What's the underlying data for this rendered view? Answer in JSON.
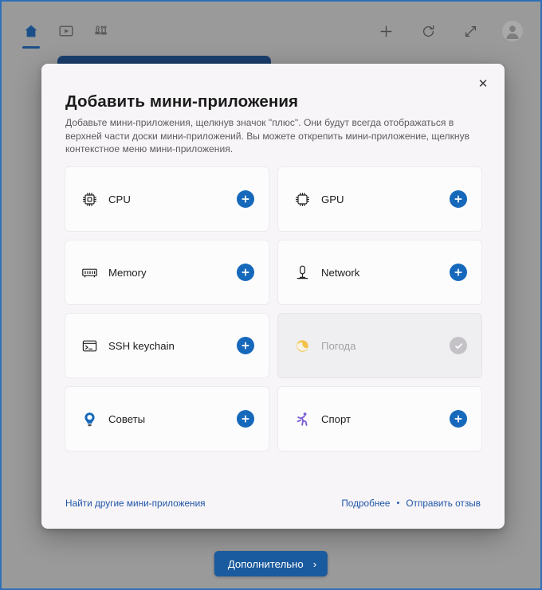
{
  "toolbar": {
    "left_items": [
      {
        "name": "home-icon",
        "label": "Home",
        "active": true
      },
      {
        "name": "video-icon",
        "label": "Video",
        "active": false
      },
      {
        "name": "chess-icon",
        "label": "Games",
        "active": false
      }
    ],
    "right_items": [
      {
        "name": "plus-icon",
        "label": "Add"
      },
      {
        "name": "refresh-icon",
        "label": "Refresh"
      },
      {
        "name": "expand-icon",
        "label": "Expand"
      },
      {
        "name": "avatar",
        "label": "Profile"
      }
    ]
  },
  "dialog": {
    "title": "Добавить мини-приложения",
    "description": "Добавьте мини-приложения, щелкнув значок \"плюс\". Они будут всегда отображаться в верхней части доски мини-приложений. Вы можете открепить мини-приложение, щелкнув контекстное меню мини-приложения.",
    "close_label": "✕",
    "widgets": [
      {
        "label": "CPU",
        "icon": "cpu-chip-icon",
        "state": "add",
        "action_label": "+"
      },
      {
        "label": "GPU",
        "icon": "gpu-chip-icon",
        "state": "add",
        "action_label": "+"
      },
      {
        "label": "Memory",
        "icon": "memory-ram-icon",
        "state": "add",
        "action_label": "+"
      },
      {
        "label": "Network",
        "icon": "network-icon",
        "state": "add",
        "action_label": "+"
      },
      {
        "label": "SSH keychain",
        "icon": "terminal-icon",
        "state": "add",
        "action_label": "+"
      },
      {
        "label": "Погода",
        "icon": "weather-sun-cloud-icon",
        "state": "added",
        "action_label": "✓"
      },
      {
        "label": "Советы",
        "icon": "lightbulb-icon",
        "state": "add",
        "action_label": "+"
      },
      {
        "label": "Спорт",
        "icon": "running-person-icon",
        "state": "add",
        "action_label": "+"
      }
    ],
    "footer": {
      "find_more": "Найти другие мини-приложения",
      "learn_more": "Подробнее",
      "separator": "•",
      "send_feedback": "Отправить отзыв"
    }
  },
  "bottom_bar": {
    "more_button": "Дополнительно",
    "more_button_chevron": "›"
  },
  "colors": {
    "accent_blue": "#1668bb",
    "link_blue": "#1f55a8",
    "button_blue": "#1a5a9e",
    "disabled_gray": "#c4c2c6",
    "dialog_bg": "#f7f5f7",
    "card_bg": "#fdfcfd",
    "backdrop_gray": "#9a9a9a"
  }
}
